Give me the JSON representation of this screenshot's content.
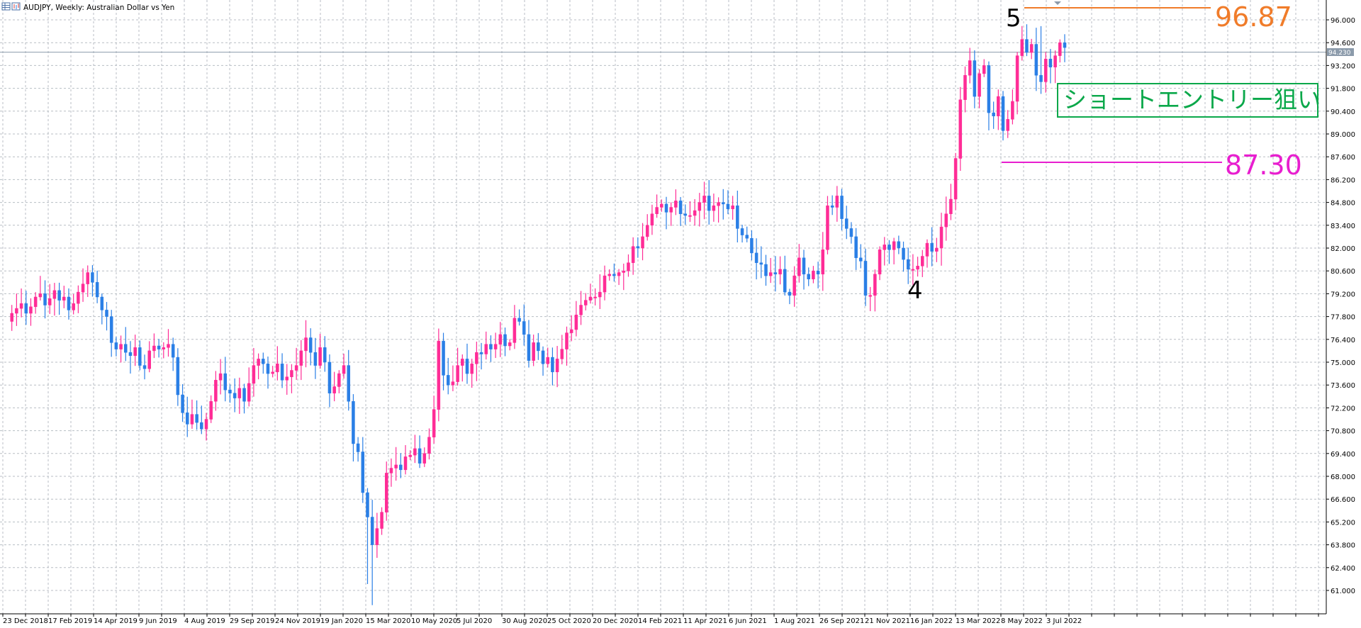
{
  "header": {
    "title": "AUDJPY, Weekly:  Australian Dollar vs Yen",
    "icons": [
      "grid-icon",
      "chart-icon"
    ]
  },
  "chart_data": {
    "type": "candlestick",
    "symbol": "AUDJPY",
    "timeframe": "Weekly",
    "description": "Australian Dollar vs Yen",
    "ylim": [
      60.0,
      96.7
    ],
    "y_ticks": [
      "96.000",
      "94.600",
      "93.200",
      "91.800",
      "90.400",
      "89.000",
      "87.600",
      "86.200",
      "84.800",
      "83.400",
      "82.000",
      "80.600",
      "79.200",
      "77.800",
      "76.400",
      "75.000",
      "73.600",
      "72.200",
      "70.800",
      "69.400",
      "68.000",
      "66.600",
      "65.200",
      "63.800",
      "62.400",
      "61.000"
    ],
    "x_ticks": [
      "23 Dec 2018",
      "17 Feb 2019",
      "14 Apr 2019",
      "9 Jun 2019",
      "4 Aug 2019",
      "29 Sep 2019",
      "24 Nov 2019",
      "19 Jan 2020",
      "15 Mar 2020",
      "10 May 2020",
      "5 Jul 2020",
      "30 Aug 2020",
      "25 Oct 2020",
      "20 Dec 2020",
      "14 Feb 2021",
      "11 Apr 2021",
      "6 Jun 2021",
      "1 Aug 2021",
      "26 Sep 2021",
      "21 Nov 2021",
      "16 Jan 2022",
      "13 Mar 2022",
      "8 May 2022",
      "3 Jul 2022"
    ],
    "closes": [
      77.5,
      78.0,
      78.3,
      78.6,
      78.0,
      78.4,
      79.0,
      79.2,
      78.5,
      78.9,
      79.4,
      78.8,
      79.0,
      78.2,
      78.6,
      79.3,
      79.8,
      80.5,
      79.9,
      79.0,
      78.2,
      77.8,
      76.2,
      75.8,
      76.1,
      75.6,
      75.4,
      75.9,
      74.8,
      74.6,
      75.7,
      76.0,
      75.8,
      75.9,
      76.1,
      75.3,
      73.0,
      71.9,
      71.2,
      71.8,
      71.3,
      70.9,
      71.5,
      72.6,
      73.9,
      74.3,
      73.3,
      73.1,
      72.8,
      73.4,
      72.6,
      73.7,
      74.8,
      75.2,
      74.9,
      74.3,
      74.4,
      74.9,
      73.9,
      74.1,
      74.5,
      74.8,
      75.7,
      76.5,
      75.6,
      74.8,
      75.9,
      75.0,
      73.1,
      73.5,
      74.3,
      74.8,
      72.6,
      70.0,
      69.5,
      67.0,
      65.5,
      63.8,
      64.8,
      65.8,
      68.2,
      68.5,
      68.7,
      68.4,
      69.2,
      69.3,
      69.7,
      68.8,
      69.4,
      70.4,
      72.1,
      76.3,
      74.2,
      73.6,
      73.8,
      74.8,
      75.2,
      74.3,
      74.9,
      75.6,
      75.5,
      76.1,
      75.8,
      76.1,
      76.7,
      76.0,
      76.2,
      77.7,
      77.5,
      76.7,
      75.1,
      76.2,
      75.7,
      74.9,
      75.3,
      74.4,
      75.2,
      75.8,
      76.8,
      77.0,
      77.9,
      78.5,
      78.8,
      79.0,
      79.0,
      79.3,
      80.3,
      80.4,
      80.3,
      80.5,
      80.6,
      81.1,
      82.1,
      82.0,
      82.7,
      83.4,
      84.1,
      84.5,
      84.7,
      84.2,
      84.5,
      84.9,
      84.1,
      84.0,
      84.0,
      84.3,
      84.8,
      85.2,
      84.3,
      84.6,
      84.8,
      84.7,
      84.4,
      84.6,
      83.2,
      82.8,
      82.6,
      81.7,
      81.1,
      81.0,
      80.3,
      80.5,
      80.4,
      80.7,
      79.3,
      79.1,
      80.3,
      81.4,
      80.4,
      80.1,
      80.6,
      80.4,
      81.9,
      84.6,
      84.5,
      85.2,
      83.8,
      83.2,
      82.7,
      81.4,
      81.2,
      79.1,
      79.1,
      80.4,
      81.9,
      82.2,
      81.9,
      82.4,
      82.0,
      81.3,
      80.7,
      80.7,
      80.9,
      81.5,
      82.3,
      81.8,
      82.0,
      83.3,
      84.1,
      85.0,
      87.5,
      91.1,
      92.6,
      93.5,
      91.3,
      92.7,
      93.2,
      90.3,
      90.1,
      91.3,
      89.2,
      89.9,
      91.0,
      93.8,
      94.8,
      94.0,
      94.5,
      92.6,
      92.2,
      93.6,
      93.1,
      93.8,
      94.6,
      94.3
    ],
    "levels": [
      {
        "value": "96.87",
        "color": "#f07c2a"
      },
      {
        "value": "87.30",
        "color": "#e81ecf"
      }
    ],
    "current_price": "94.230",
    "annotations": {
      "wave_4": "4",
      "wave_5": "5",
      "entry_box": "ショートエントリー狙い"
    },
    "colors": {
      "bull": "#ff2c96",
      "bear": "#2a7fe6",
      "grid": "#b8bec4",
      "entry": "#0aa84a",
      "price_line": "#8c9bab"
    }
  }
}
